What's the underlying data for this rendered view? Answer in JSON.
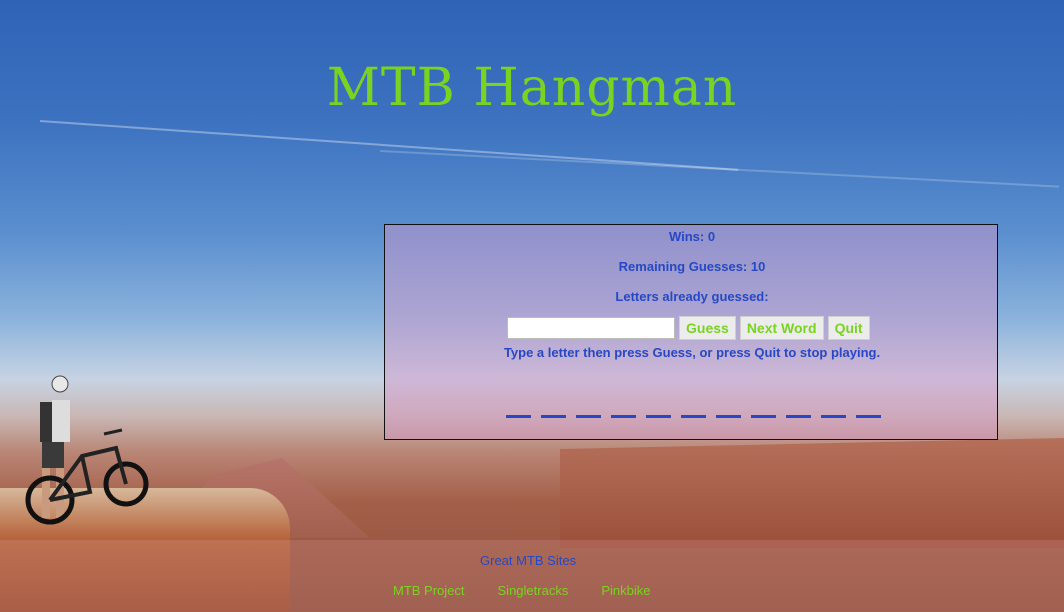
{
  "app": {
    "title": "MTB Hangman"
  },
  "game": {
    "wins_text": "Wins: 0",
    "remaining_text": "Remaining Guesses: 10",
    "letters_guessed_text": "Letters already guessed:",
    "input_value": "",
    "input_placeholder": "",
    "guess_label": "Guess",
    "next_word_label": "Next Word",
    "quit_label": "Quit",
    "instructions": "Type a letter then press Guess, or press Quit to stop playing.",
    "word_blanks": 11
  },
  "footer": {
    "heading": "Great MTB Sites",
    "links": [
      "MTB Project",
      "Singletracks",
      "Pinkbike"
    ]
  },
  "colors": {
    "accent_green": "#7ad321",
    "text_blue": "#2748c4"
  }
}
